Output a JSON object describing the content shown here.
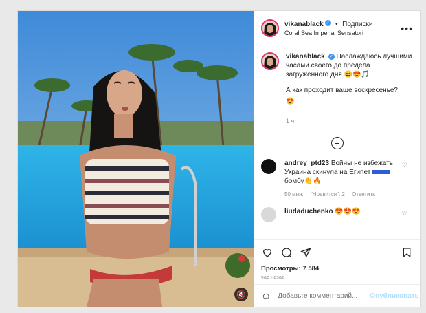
{
  "post": {
    "author": "vikanablack",
    "follow_label": "Подписки",
    "dot": "•",
    "location": "Coral Sea Imperial Sensatori",
    "more": "•••",
    "caption": "Наслаждаюсь лучшими часами своего до предела загруженного дня 😄😍🎵",
    "question": "А как проходит ваше воскресенье?",
    "question_emoji": "😍",
    "time": "1 ч.",
    "load_more": "+"
  },
  "comments": [
    {
      "user": "andrey_ptd23",
      "text_before": "Войны не избежать Украина скинула на Египет",
      "text_after": "бомбу👏🔥",
      "time": "50 мин.",
      "likes": "\"Нравится\": 2",
      "reply": "Ответить"
    },
    {
      "user": "liudaduchenko",
      "text": "😍😍😍"
    }
  ],
  "views": "Просмотры: 7 584",
  "time_ago": "час назад",
  "comment_input": {
    "placeholder": "Добавьте комментарий...",
    "emoji": "☺",
    "publish": "Опубликовать"
  },
  "mute": "🔇",
  "icons": {
    "like": "heart-icon",
    "comment": "comment-icon",
    "share": "paper-plane-icon",
    "save": "bookmark-icon"
  }
}
